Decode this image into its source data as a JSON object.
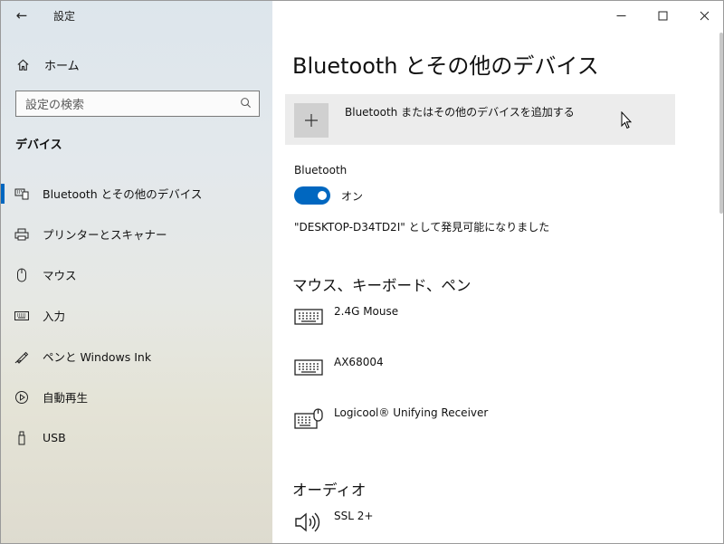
{
  "app": {
    "title": "設定"
  },
  "window_buttons": {
    "minimize": "—",
    "maximize": "☐",
    "close": "✕"
  },
  "sidebar": {
    "home_label": "ホーム",
    "search_placeholder": "設定の検索",
    "section_title": "デバイス",
    "items": [
      {
        "label": "Bluetooth とその他のデバイス",
        "icon": "bluetooth-devices-icon",
        "selected": true
      },
      {
        "label": "プリンターとスキャナー",
        "icon": "printer-icon"
      },
      {
        "label": "マウス",
        "icon": "mouse-icon"
      },
      {
        "label": "入力",
        "icon": "keyboard-icon"
      },
      {
        "label": "ペンと Windows Ink",
        "icon": "pen-icon"
      },
      {
        "label": "自動再生",
        "icon": "autoplay-icon"
      },
      {
        "label": "USB",
        "icon": "usb-icon"
      }
    ]
  },
  "main": {
    "title": "Bluetooth とその他のデバイス",
    "add_device_label": "Bluetooth またはその他のデバイスを追加する",
    "bluetooth_label": "Bluetooth",
    "bluetooth_state": "オン",
    "bluetooth_on": true,
    "discoverable_text": "\"DESKTOP-D34TD2I\" として発見可能になりました",
    "sections": {
      "input_title": "マウス、キーボード、ペン",
      "audio_title": "オーディオ"
    },
    "devices": [
      {
        "name": "2.4G Mouse",
        "icon": "keyboard-icon"
      },
      {
        "name": "AX68004",
        "icon": "keyboard-icon"
      },
      {
        "name": "Logicool® Unifying Receiver",
        "icon": "keyboard-mouse-icon"
      }
    ],
    "audio_devices": [
      {
        "name": "SSL 2+",
        "icon": "speaker-icon"
      }
    ]
  },
  "colors": {
    "accent": "#0067c0",
    "add_button_bg": "#ececec"
  }
}
